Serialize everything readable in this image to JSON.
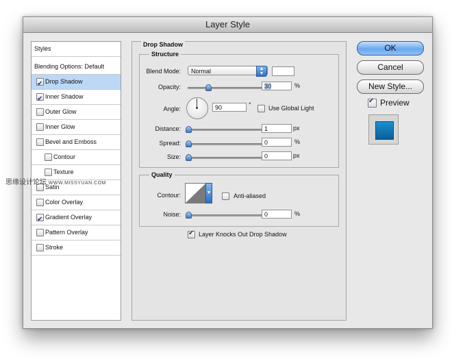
{
  "window": {
    "title": "Layer Style"
  },
  "styles_list": {
    "header": "Styles",
    "blending": "Blending Options: Default",
    "items": [
      {
        "label": "Drop Shadow",
        "checked": true,
        "selected": true
      },
      {
        "label": "Inner Shadow",
        "checked": true
      },
      {
        "label": "Outer Glow",
        "checked": false
      },
      {
        "label": "Inner Glow",
        "checked": false
      },
      {
        "label": "Bevel and Emboss",
        "checked": false
      },
      {
        "label": "Contour",
        "checked": false,
        "indent": true
      },
      {
        "label": "Texture",
        "checked": false,
        "indent": true
      },
      {
        "label": "Satin",
        "checked": false
      },
      {
        "label": "Color Overlay",
        "checked": false
      },
      {
        "label": "Gradient Overlay",
        "checked": true
      },
      {
        "label": "Pattern Overlay",
        "checked": false
      },
      {
        "label": "Stroke",
        "checked": false
      }
    ]
  },
  "panel": {
    "title": "Drop Shadow",
    "structure": {
      "legend": "Structure",
      "blend_mode_label": "Blend Mode:",
      "blend_mode_value": "Normal",
      "opacity_label": "Opacity:",
      "opacity_value": "30",
      "opacity_unit": "%",
      "angle_label": "Angle:",
      "angle_value": "90",
      "angle_unit": "°",
      "global_light_label": "Use Global Light",
      "global_light_checked": false,
      "distance_label": "Distance:",
      "distance_value": "1",
      "distance_unit": "px",
      "spread_label": "Spread:",
      "spread_value": "0",
      "spread_unit": "%",
      "size_label": "Size:",
      "size_value": "0",
      "size_unit": "px"
    },
    "quality": {
      "legend": "Quality",
      "contour_label": "Contour:",
      "anti_aliased_label": "Anti-aliased",
      "anti_aliased_checked": false,
      "noise_label": "Noise:",
      "noise_value": "0",
      "noise_unit": "%"
    },
    "knockout_label": "Layer Knocks Out Drop Shadow",
    "knockout_checked": true
  },
  "buttons": {
    "ok": "OK",
    "cancel": "Cancel",
    "new_style": "New Style...",
    "preview_label": "Preview",
    "preview_checked": true
  },
  "watermark": {
    "cn": "思缘设计论坛",
    "url": "WWW.MISSYUAN.COM"
  },
  "colors": {
    "accent": "#6aa9ee",
    "selection": "#bcd8f6",
    "preview_fill": "#0f76b5"
  }
}
